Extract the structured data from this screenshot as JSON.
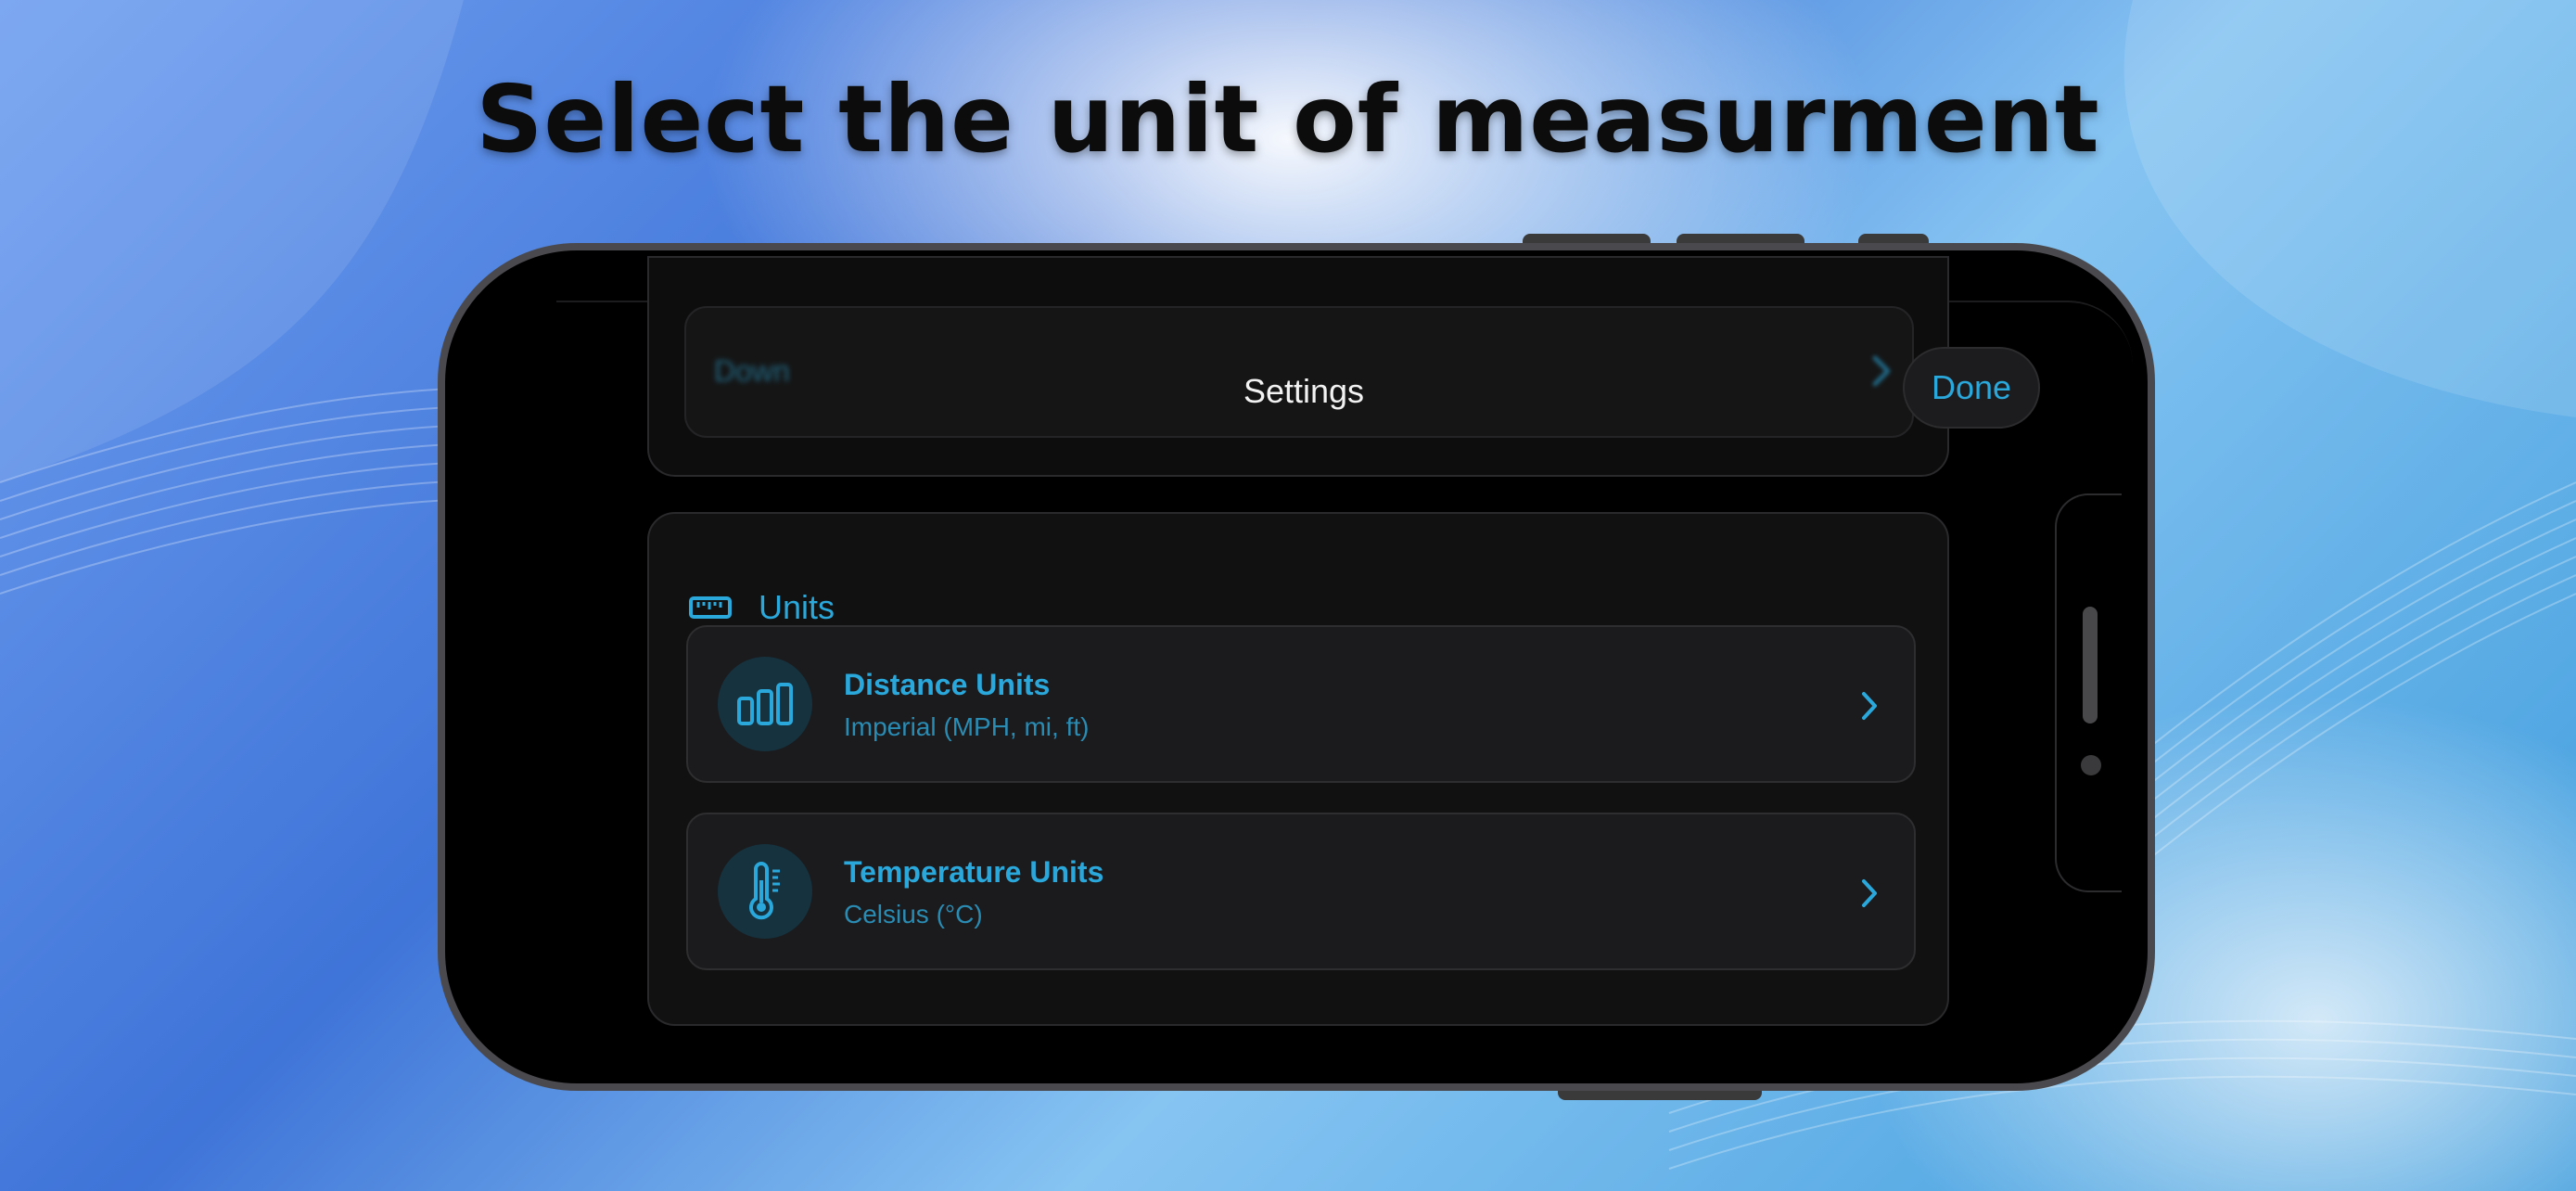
{
  "headline": "Select the unit of measurment",
  "colors": {
    "accent": "#2aa8dc",
    "screen_bg": "#000000",
    "card_bg": "#111111",
    "row_bg": "#1b1b1d"
  },
  "nav": {
    "title": "Settings",
    "done_label": "Done",
    "blurred_row_label": "Down"
  },
  "units_section": {
    "icon": "ruler-icon",
    "title": "Units",
    "rows": [
      {
        "icon": "bar-chart-icon",
        "title": "Distance Units",
        "value": "Imperial (MPH, mi, ft)"
      },
      {
        "icon": "thermometer-icon",
        "title": "Temperature Units",
        "value": "Celsius (°C)"
      }
    ]
  }
}
